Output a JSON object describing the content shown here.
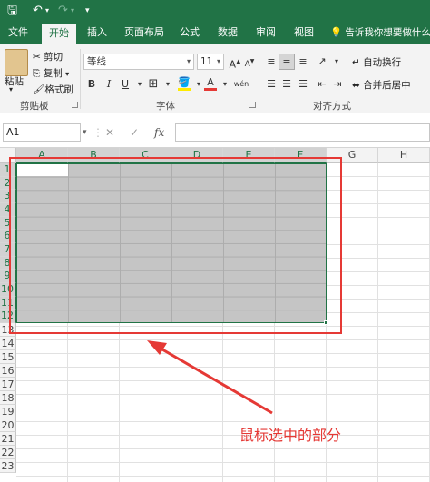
{
  "qat": {
    "save_icon": "save-icon",
    "undo_icon": "undo-icon",
    "redo_icon": "redo-icon",
    "customize_icon": "customize-qat-icon"
  },
  "tabs": [
    {
      "label": "文件"
    },
    {
      "label": "开始"
    },
    {
      "label": "插入"
    },
    {
      "label": "页面布局"
    },
    {
      "label": "公式"
    },
    {
      "label": "数据"
    },
    {
      "label": "审阅"
    },
    {
      "label": "视图"
    }
  ],
  "active_tab": "开始",
  "tellme": "告诉我你想要做什么",
  "clipboard": {
    "paste": "粘贴",
    "cut": "剪切",
    "copy": "复制",
    "format_painter": "格式刷",
    "group": "剪贴板"
  },
  "font": {
    "name": "等线",
    "size": "11",
    "group": "字体",
    "bold": "B",
    "italic": "I",
    "underline": "U",
    "grow": "A",
    "shrink": "A",
    "font_color_label": "A",
    "phonetic": "wén"
  },
  "alignment": {
    "wrap": "自动换行",
    "merge": "合并后居中",
    "group": "对齐方式"
  },
  "formula_bar": {
    "name_box": "A1",
    "cancel": "✕",
    "enter": "✓",
    "fx": "fx",
    "formula": ""
  },
  "columns": [
    "A",
    "B",
    "C",
    "D",
    "E",
    "F",
    "G",
    "H"
  ],
  "rows": [
    "1",
    "2",
    "3",
    "4",
    "5",
    "6",
    "7",
    "8",
    "9",
    "10",
    "11",
    "12",
    "13",
    "14",
    "15",
    "16",
    "17",
    "18",
    "19",
    "20",
    "21",
    "22",
    "23"
  ],
  "selection": "A1:F12",
  "annotation": "鼠标选中的部分",
  "colors": {
    "excel_green": "#217346",
    "annotation_red": "#e53935",
    "selection_gray": "#c5c5c5"
  }
}
